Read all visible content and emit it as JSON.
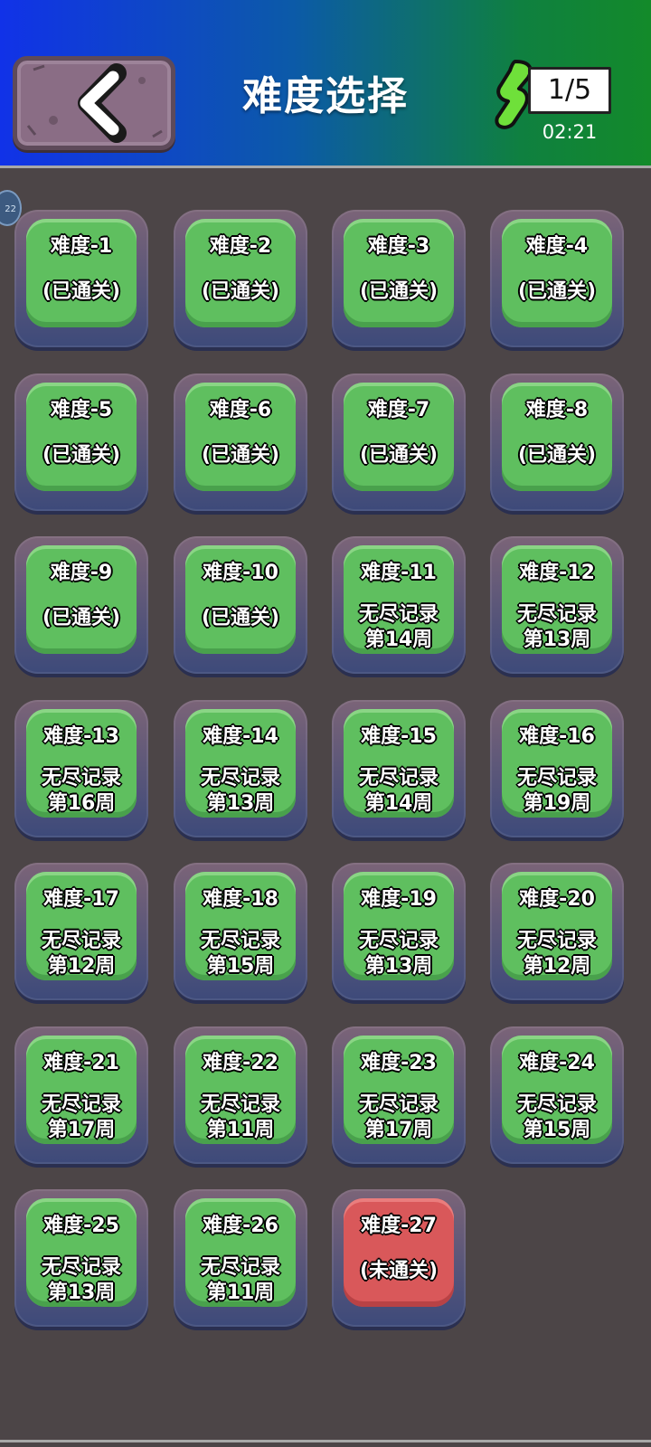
{
  "header": {
    "title": "难度选择",
    "energy": "1/5",
    "timer": "02:21",
    "left_badge": "22",
    "colors": {
      "gradient_left": "#1132e8",
      "gradient_right": "#138a2a",
      "energy_green": "#6fe03a"
    }
  },
  "icons": {
    "back": "chevron-left-icon",
    "energy": "lightning-bolt-icon"
  },
  "levels": [
    {
      "name": "难度-1",
      "status": "(已通关)",
      "state": "cleared"
    },
    {
      "name": "难度-2",
      "status": "(已通关)",
      "state": "cleared"
    },
    {
      "name": "难度-3",
      "status": "(已通关)",
      "state": "cleared"
    },
    {
      "name": "难度-4",
      "status": "(已通关)",
      "state": "cleared"
    },
    {
      "name": "难度-5",
      "status": "(已通关)",
      "state": "cleared"
    },
    {
      "name": "难度-6",
      "status": "(已通关)",
      "state": "cleared"
    },
    {
      "name": "难度-7",
      "status": "(已通关)",
      "state": "cleared"
    },
    {
      "name": "难度-8",
      "status": "(已通关)",
      "state": "cleared"
    },
    {
      "name": "难度-9",
      "status": "(已通关)",
      "state": "cleared"
    },
    {
      "name": "难度-10",
      "status": "(已通关)",
      "state": "cleared"
    },
    {
      "name": "难度-11",
      "status": "无尽记录",
      "record": "第14周",
      "state": "endless"
    },
    {
      "name": "难度-12",
      "status": "无尽记录",
      "record": "第13周",
      "state": "endless"
    },
    {
      "name": "难度-13",
      "status": "无尽记录",
      "record": "第16周",
      "state": "endless"
    },
    {
      "name": "难度-14",
      "status": "无尽记录",
      "record": "第13周",
      "state": "endless"
    },
    {
      "name": "难度-15",
      "status": "无尽记录",
      "record": "第14周",
      "state": "endless"
    },
    {
      "name": "难度-16",
      "status": "无尽记录",
      "record": "第19周",
      "state": "endless"
    },
    {
      "name": "难度-17",
      "status": "无尽记录",
      "record": "第12周",
      "state": "endless"
    },
    {
      "name": "难度-18",
      "status": "无尽记录",
      "record": "第15周",
      "state": "endless"
    },
    {
      "name": "难度-19",
      "status": "无尽记录",
      "record": "第13周",
      "state": "endless"
    },
    {
      "name": "难度-20",
      "status": "无尽记录",
      "record": "第12周",
      "state": "endless"
    },
    {
      "name": "难度-21",
      "status": "无尽记录",
      "record": "第17周",
      "state": "endless"
    },
    {
      "name": "难度-22",
      "status": "无尽记录",
      "record": "第11周",
      "state": "endless"
    },
    {
      "name": "难度-23",
      "status": "无尽记录",
      "record": "第17周",
      "state": "endless"
    },
    {
      "name": "难度-24",
      "status": "无尽记录",
      "record": "第15周",
      "state": "endless"
    },
    {
      "name": "难度-25",
      "status": "无尽记录",
      "record": "第13周",
      "state": "endless"
    },
    {
      "name": "难度-26",
      "status": "无尽记录",
      "record": "第11周",
      "state": "endless"
    },
    {
      "name": "难度-27",
      "status": "(未通关)",
      "state": "locked"
    }
  ]
}
